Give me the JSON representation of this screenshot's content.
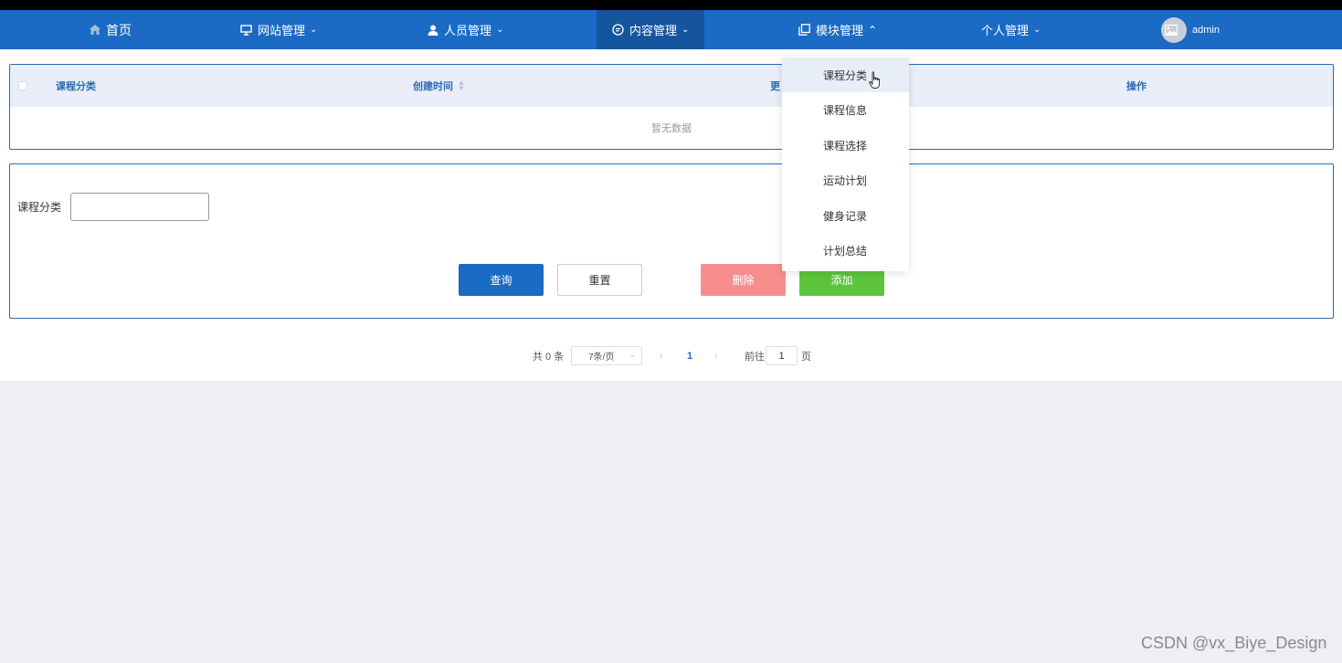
{
  "nav": {
    "home": "首页",
    "site_mgmt": "网站管理",
    "people_mgmt": "人员管理",
    "content_mgmt": "内容管理",
    "module_mgmt": "模块管理",
    "personal_mgmt": "个人管理",
    "username": "admin"
  },
  "table": {
    "headers": [
      "课程分类",
      "创建时间",
      "更",
      "操作"
    ],
    "empty_text": "暂无数据"
  },
  "search": {
    "label": "课程分类",
    "value": ""
  },
  "buttons": {
    "query": "查询",
    "reset": "重置",
    "delete": "删除",
    "add": "添加"
  },
  "pagination": {
    "total": "共 0 条",
    "page_size": "7条/页",
    "current_page": "1",
    "goto_label": "前往",
    "goto_value": "1",
    "page_suffix": "页"
  },
  "dropdown": {
    "items": [
      "课程分类",
      "课程信息",
      "课程选择",
      "运动计划",
      "健身记录",
      "计划总结"
    ]
  },
  "watermark": "CSDN @vx_Biye_Design",
  "colors": {
    "nav": "#1b6bc4",
    "nav_active": "#15559d",
    "delete": "#f78d8d",
    "add": "#5dc53c"
  }
}
